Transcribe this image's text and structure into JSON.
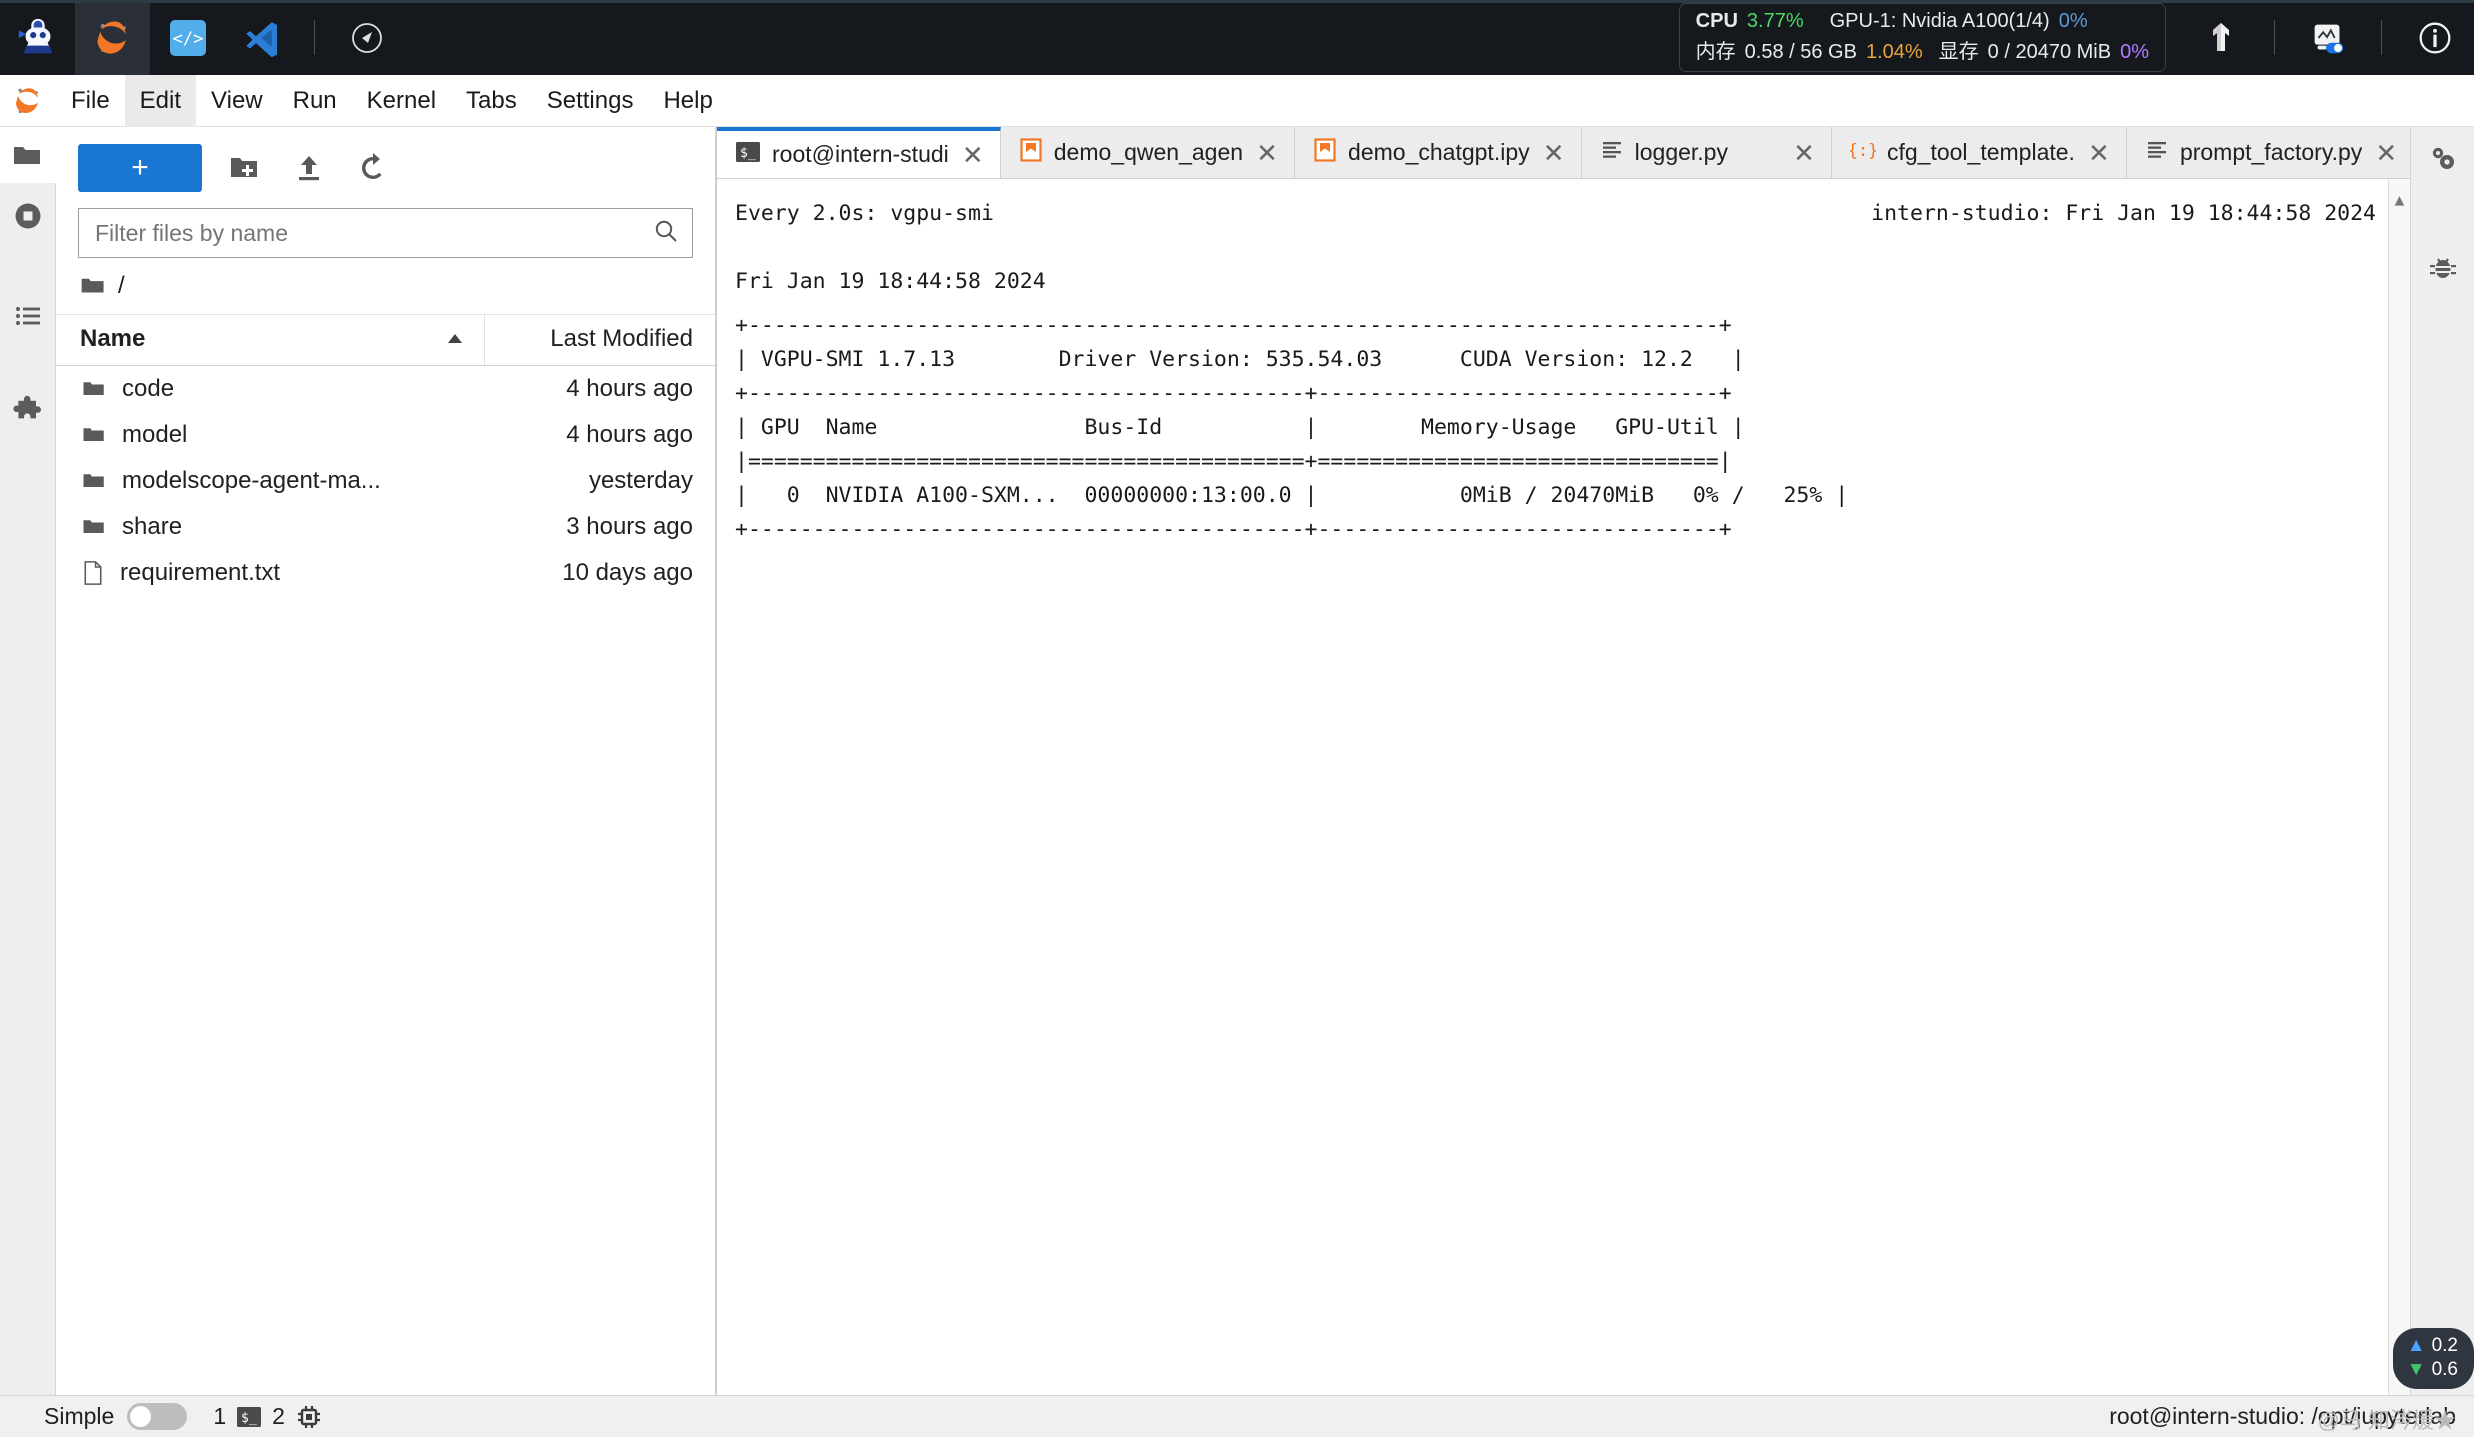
{
  "topbar": {
    "apps": [
      {
        "name": "intern-studio-logo-icon",
        "label": "InternStudio"
      },
      {
        "name": "jupyter-icon",
        "label": "Jupyter",
        "selected": true
      },
      {
        "name": "code-server-icon",
        "label": "Code Server"
      },
      {
        "name": "vscode-icon",
        "label": "VS Code"
      },
      {
        "name": "compass-icon",
        "label": "Explore"
      }
    ],
    "status": {
      "cpu_label": "CPU",
      "cpu_value": "3.77%",
      "cpu_color": "#4cd964",
      "mem_label": "内存",
      "mem_value": "0.58 / 56 GB",
      "mem_percent": "1.04%",
      "mem_percent_color": "#e8a33d",
      "gpu_label": "GPU-1: Nvidia A100(1/4)",
      "gpu_value": "0%",
      "gpu_color": "#5b9bd5",
      "vram_label": "显存",
      "vram_value": "0 / 20470 MiB",
      "vram_percent": "0%",
      "vram_percent_color": "#b07cff"
    },
    "right_icons": [
      {
        "name": "tensorboard-icon",
        "label": "TensorBoard"
      },
      {
        "name": "monitor-toggle-icon",
        "label": "Monitor"
      },
      {
        "name": "info-icon",
        "label": "Info"
      }
    ]
  },
  "menubar": {
    "logo": "jupyter-logo-icon",
    "items": [
      {
        "label": "File",
        "active": false
      },
      {
        "label": "Edit",
        "active": true
      },
      {
        "label": "View",
        "active": false
      },
      {
        "label": "Run",
        "active": false
      },
      {
        "label": "Kernel",
        "active": false
      },
      {
        "label": "Tabs",
        "active": false
      },
      {
        "label": "Settings",
        "active": false
      },
      {
        "label": "Help",
        "active": false
      }
    ]
  },
  "left_rail": [
    {
      "name": "sidebar-item-file-browser",
      "icon": "folder-icon",
      "active": true
    },
    {
      "name": "sidebar-item-running",
      "icon": "stop-circle-icon",
      "active": false
    },
    {
      "name": "sidebar-item-commands",
      "icon": "list-icon",
      "active": false
    },
    {
      "name": "sidebar-item-extensions",
      "icon": "puzzle-icon",
      "active": false
    }
  ],
  "right_rail": [
    {
      "name": "sidebar-item-property-inspector",
      "icon": "gears-icon"
    },
    {
      "name": "sidebar-item-debugger",
      "icon": "bug-icon"
    }
  ],
  "filebrowser": {
    "new_button_label": "+",
    "toolbar_icons": [
      {
        "name": "new-folder-icon",
        "label": "New Folder"
      },
      {
        "name": "upload-icon",
        "label": "Upload"
      },
      {
        "name": "refresh-icon",
        "label": "Refresh"
      }
    ],
    "filter_placeholder": "Filter files by name",
    "filter_value": "",
    "search_icon": "search-icon",
    "breadcrumb": "/",
    "columns": {
      "name": "Name",
      "modified": "Last Modified"
    },
    "sort_direction": "ascending",
    "items": [
      {
        "name": "code",
        "modified": "4 hours ago",
        "type": "folder"
      },
      {
        "name": "model",
        "modified": "4 hours ago",
        "type": "folder"
      },
      {
        "name": "modelscope-agent-ma...",
        "modified": "yesterday",
        "type": "folder"
      },
      {
        "name": "share",
        "modified": "3 hours ago",
        "type": "folder"
      },
      {
        "name": "requirement.txt",
        "modified": "10 days ago",
        "type": "file"
      }
    ]
  },
  "dock": {
    "tabs": [
      {
        "label": "root@intern-studi",
        "icon": "terminal-icon",
        "active": true
      },
      {
        "label": "demo_qwen_agen",
        "icon": "notebook-icon",
        "active": false
      },
      {
        "label": "demo_chatgpt.ipy",
        "icon": "notebook-icon",
        "active": false
      },
      {
        "label": "logger.py",
        "icon": "text-file-icon",
        "active": false,
        "wide": true
      },
      {
        "label": "cfg_tool_template.",
        "icon": "json-icon",
        "active": false
      },
      {
        "label": "prompt_factory.py",
        "icon": "text-file-icon",
        "active": false
      }
    ],
    "add_tab_label": "+"
  },
  "terminal": {
    "watch_header": "Every 2.0s: vgpu-smi",
    "watch_host": "intern-studio: Fri Jan 19 18:44:58 2024",
    "date_line": "Fri Jan 19 18:44:58 2024",
    "table": "+---------------------------------------------------------------------------+\n| VGPU-SMI 1.7.13        Driver Version: 535.54.03      CUDA Version: 12.2   |\n+-------------------------------------------+-------------------------------+\n| GPU  Name                Bus-Id           |        Memory-Usage   GPU-Util |\n|===========================================+===============================|\n|   0  NVIDIA A100-SXM...  00000000:13:00.0 |           0MiB / 20470MiB    0% /   25% |\n+-------------------------------------------+-------------------------------+"
  },
  "terminal_lines": {
    "l1": "+---------------------------------------------------------------------------+",
    "l2": "| VGPU-SMI 1.7.13        Driver Version: 535.54.03      CUDA Version: 12.2   |",
    "l3": "+-------------------------------------------+-------------------------------+",
    "l4": "| GPU  Name                Bus-Id           |        Memory-Usage   GPU-Util |",
    "l5": "|===========================================+===============================|",
    "l6": "|   0  NVIDIA A100-SXM...  00000000:13:00.0 |           0MiB / 20470MiB   0% /   25% |",
    "l7": "+-------------------------------------------+-------------------------------+"
  },
  "statusbar": {
    "simple_label": "Simple",
    "simple_enabled": false,
    "count_left": "1",
    "terminal_icon": "terminal-icon",
    "count_right": "2",
    "kernel_icon": "chip-icon",
    "path": "root@intern-studio: /opt/jupyterlab",
    "watermark": "@马 知涔煖★"
  },
  "network_widget": {
    "upload": "0.2",
    "download": "0.6",
    "up_icon": "arrow-up-icon",
    "down_icon": "arrow-down-icon"
  }
}
